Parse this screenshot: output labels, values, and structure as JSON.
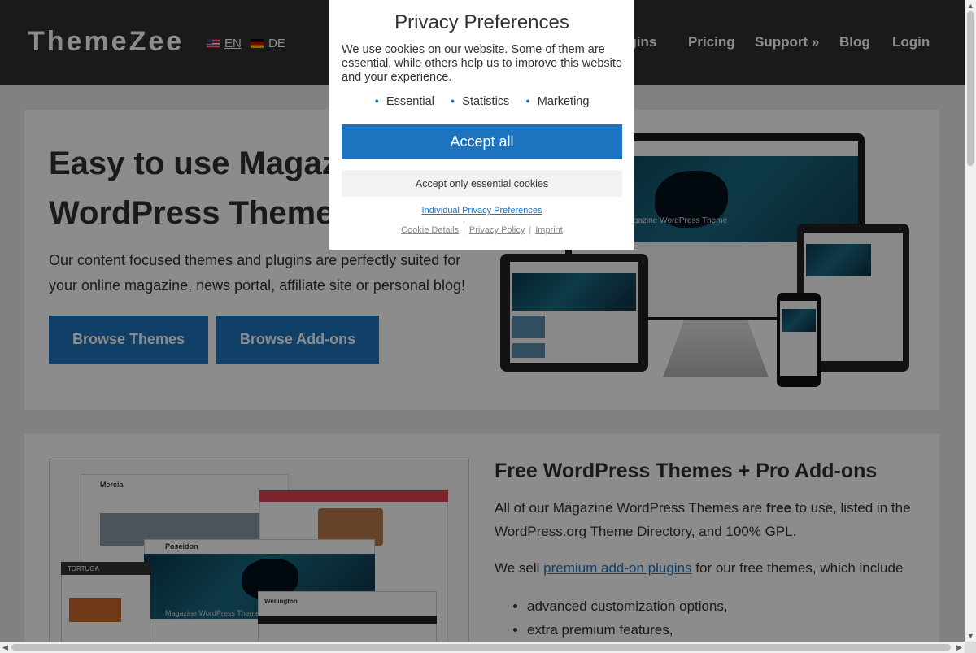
{
  "header": {
    "logo": "ThemeZee",
    "languages": [
      {
        "code": "EN",
        "flag": "us-flag-icon"
      },
      {
        "code": "DE",
        "flag": "de-flag-icon"
      }
    ],
    "nav": [
      "ugins",
      "Pricing",
      "Support »",
      "Blog",
      "Login"
    ]
  },
  "hero": {
    "title": "Easy to use Magazine WordPress Themes",
    "text": "Our content focused themes and plugins are perfectly suited for your online magazine, news portal, affiliate site or personal blog!",
    "buttons": {
      "themes": "Browse Themes",
      "addons": "Browse Add-ons"
    },
    "mockup_caption": "Magazine WordPress Theme"
  },
  "features": {
    "title": "Free WordPress Themes + Pro Add-ons",
    "p1_before": "All of our Magazine WordPress Themes are ",
    "p1_bold": "free",
    "p1_after": " to use, listed in the WordPress.org Theme Directory, and 100% GPL.",
    "p2_before": "We sell ",
    "p2_link": "premium add-on plugins",
    "p2_after": " for our free themes, which include",
    "list": [
      "advanced customization options,",
      "extra premium features,"
    ],
    "screenshot_labels": [
      "Mercia",
      "Poseidon",
      "TORTUGA",
      "Wellington",
      "Magazine WordPress Theme"
    ]
  },
  "modal": {
    "title": "Privacy Preferences",
    "text": "We use cookies on our website. Some of them are essential, while others help us to improve this website and your experience.",
    "categories": [
      "Essential",
      "Statistics",
      "Marketing"
    ],
    "accept_all": "Accept all",
    "accept_essential": "Accept only essential cookies",
    "individual": "Individual Privacy Preferences",
    "links": [
      "Cookie Details",
      "Privacy Policy",
      "Imprint"
    ]
  },
  "colors": {
    "accent": "#1e73be",
    "header_bg": "#303030"
  }
}
